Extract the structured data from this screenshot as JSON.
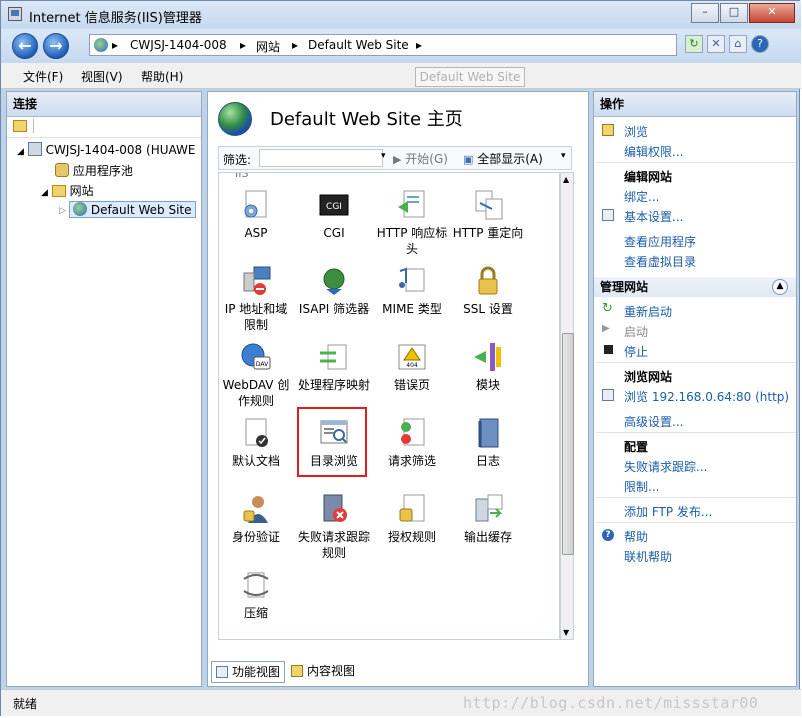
{
  "window": {
    "title": "Internet 信息服务(IIS)管理器"
  },
  "nav": {
    "crumbs": [
      "CWJSJ-1404-008",
      "网站",
      "Default Web Site"
    ],
    "tooltip": "Default Web Site"
  },
  "menu": {
    "items": [
      "文件(F)",
      "视图(V)",
      "帮助(H)"
    ]
  },
  "connections": {
    "header": "连接",
    "tree": [
      {
        "label": "CWJSJ-1404-008 (HUAWE"
      },
      {
        "label": "应用程序池"
      },
      {
        "label": "网站"
      },
      {
        "label": "Default Web Site"
      }
    ]
  },
  "center": {
    "title": "Default Web Site 主页",
    "filter_label": "筛选:",
    "start_label": "开始(G)",
    "showall_label": "全部显示(A)",
    "group_partial": "IIS",
    "features": [
      {
        "label": "ASP",
        "icon": "asp-icon"
      },
      {
        "label": "CGI",
        "icon": "cgi-icon"
      },
      {
        "label": "HTTP 响应标头",
        "icon": "http-headers-icon"
      },
      {
        "label": "HTTP 重定向",
        "icon": "http-redirect-icon"
      },
      {
        "label": "IP 地址和域限制",
        "icon": "ip-restrict-icon"
      },
      {
        "label": "ISAPI 筛选器",
        "icon": "isapi-icon"
      },
      {
        "label": "MIME 类型",
        "icon": "mime-icon"
      },
      {
        "label": "SSL 设置",
        "icon": "lock-icon"
      },
      {
        "label": "WebDAV 创作规则",
        "icon": "webdav-icon"
      },
      {
        "label": "处理程序映射",
        "icon": "handler-icon"
      },
      {
        "label": "错误页",
        "icon": "error-page-icon"
      },
      {
        "label": "模块",
        "icon": "modules-icon"
      },
      {
        "label": "默认文档",
        "icon": "default-doc-icon"
      },
      {
        "label": "目录浏览",
        "icon": "dir-browse-icon"
      },
      {
        "label": "请求筛选",
        "icon": "request-filter-icon"
      },
      {
        "label": "日志",
        "icon": "log-icon"
      },
      {
        "label": "身份验证",
        "icon": "auth-icon"
      },
      {
        "label": "失败请求跟踪规则",
        "icon": "failed-trace-icon"
      },
      {
        "label": "授权规则",
        "icon": "authz-icon"
      },
      {
        "label": "输出缓存",
        "icon": "output-cache-icon"
      },
      {
        "label": "压缩",
        "icon": "compress-icon"
      }
    ],
    "views": {
      "features": "功能视图",
      "content": "内容视图"
    }
  },
  "actions": {
    "header": "操作",
    "explore": "浏览",
    "edit_perm": "编辑权限...",
    "edit_site_h": "编辑网站",
    "bindings": "绑定...",
    "basic": "基本设置...",
    "view_apps": "查看应用程序",
    "view_vdirs": "查看虚拟目录",
    "manage_h": "管理网站",
    "restart": "重新启动",
    "start": "启动",
    "stop": "停止",
    "browse_h": "浏览网站",
    "browse_link": "浏览 192.168.0.64:80 (http)",
    "advanced": "高级设置...",
    "config_h": "配置",
    "failed_trace": "失败请求跟踪...",
    "limits": "限制...",
    "add_ftp": "添加 FTP 发布...",
    "help": "帮助",
    "online_help": "联机帮助"
  },
  "status": {
    "text": "就绪",
    "watermark": "http://blog.csdn.net/missstar00"
  }
}
